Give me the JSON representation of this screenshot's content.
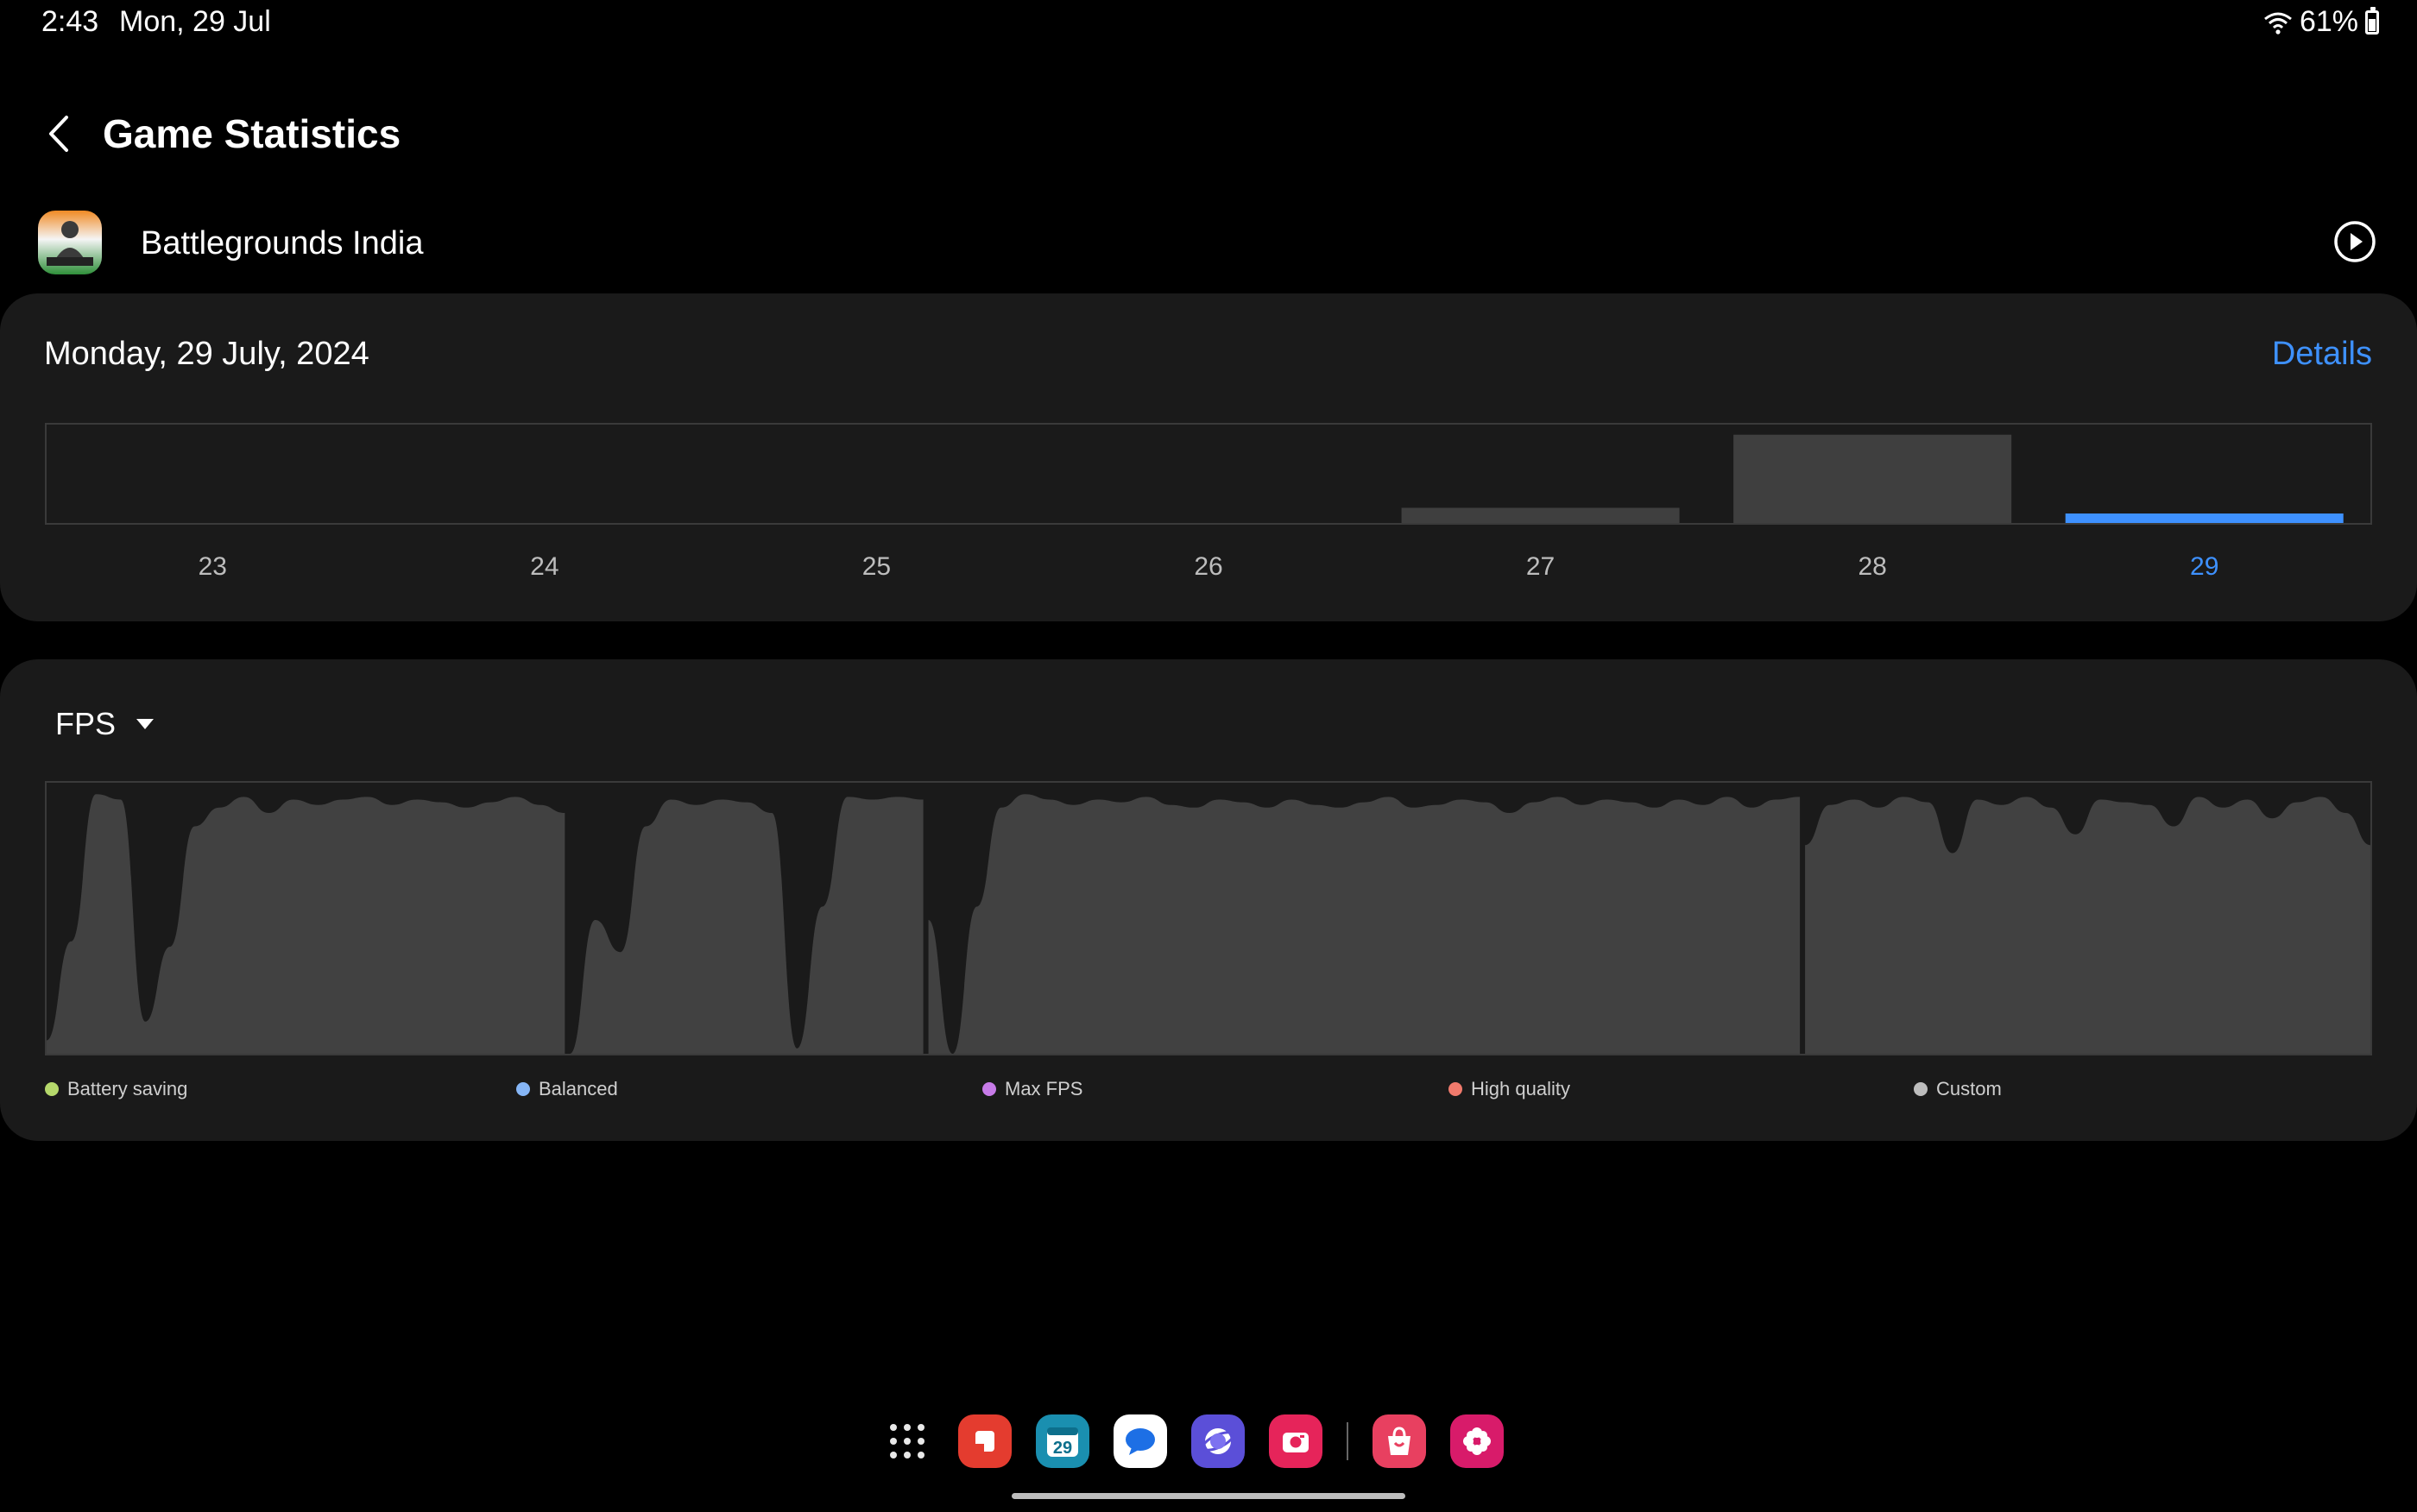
{
  "status_bar": {
    "time": "2:43",
    "date": "Mon, 29 Jul",
    "battery": "61%"
  },
  "header": {
    "title": "Game Statistics"
  },
  "game": {
    "name": "Battlegrounds India"
  },
  "daily": {
    "selected_date": "Monday, 29 July, 2024",
    "details_label": "Details",
    "selected_color": "#3e91ff",
    "bar_color": "#3f3f3f",
    "days": [
      "23",
      "24",
      "25",
      "26",
      "27",
      "28",
      "29"
    ],
    "values": [
      0,
      0,
      0,
      0,
      0.16,
      0.93,
      0.1
    ],
    "selected_index": 6
  },
  "fps": {
    "selector_label": "FPS",
    "fill_color": "#414141",
    "series": [
      [
        0.05,
        0.42,
        0.97,
        0.95,
        0.12,
        0.4,
        0.85,
        0.92,
        0.96,
        0.9,
        0.95,
        0.93,
        0.95,
        0.96,
        0.93,
        0.95,
        0.94,
        0.92,
        0.94,
        0.96,
        0.93,
        0.9
      ],
      [
        0.0,
        0.5,
        0.38,
        0.85,
        0.95,
        0.93,
        0.95,
        0.94,
        0.9,
        0.02,
        0.55,
        0.96,
        0.95,
        0.96,
        0.95
      ],
      [
        0.5,
        0.0,
        0.55,
        0.92,
        0.97,
        0.95,
        0.93,
        0.95,
        0.94,
        0.96,
        0.93,
        0.92,
        0.95,
        0.94,
        0.92,
        0.95,
        0.93,
        0.92,
        0.94,
        0.96,
        0.92,
        0.93,
        0.95,
        0.94,
        0.9,
        0.94,
        0.96,
        0.93,
        0.95,
        0.94,
        0.92,
        0.95,
        0.93,
        0.96,
        0.92,
        0.95,
        0.96
      ],
      [
        0.78,
        0.93,
        0.95,
        0.92,
        0.96,
        0.94,
        0.75,
        0.95,
        0.93,
        0.96,
        0.92,
        0.82,
        0.95,
        0.94,
        0.93,
        0.85,
        0.96,
        0.92,
        0.95,
        0.88,
        0.94,
        0.96,
        0.9,
        0.78
      ]
    ]
  },
  "legend": [
    {
      "label": "Battery saving",
      "color": "#b5d86b"
    },
    {
      "label": "Balanced",
      "color": "#86b6f6"
    },
    {
      "label": "Max FPS",
      "color": "#c77be8"
    },
    {
      "label": "High quality",
      "color": "#f07a6c"
    },
    {
      "label": "Custom",
      "color": "#bdbdbd"
    }
  ],
  "dock": {
    "apps": [
      {
        "name": "notes-app-icon",
        "color": "#e43c2f"
      },
      {
        "name": "calendar-app-icon",
        "color": "#1a8fb0",
        "text": "29"
      },
      {
        "name": "messages-app-icon",
        "color": "#1d6fe5"
      },
      {
        "name": "internet-app-icon",
        "color": "#5b4fd8"
      },
      {
        "name": "camera-app-icon",
        "color": "#e6245a"
      },
      {
        "name": "galaxy-store-app-icon",
        "color": "#e84060"
      },
      {
        "name": "gallery-app-icon",
        "color": "#d81b6a"
      }
    ]
  }
}
